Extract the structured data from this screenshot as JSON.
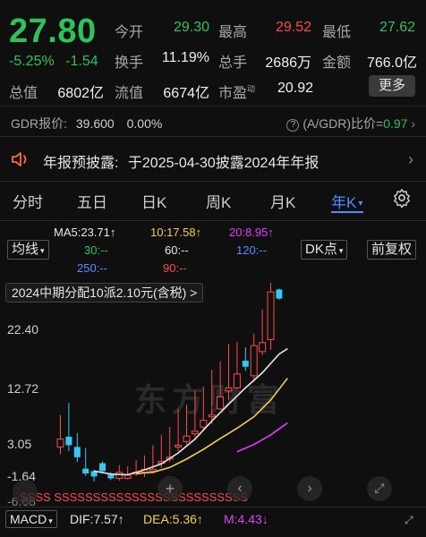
{
  "quote": {
    "price": "27.80",
    "change_pct": "-5.25%",
    "change_abs": "-1.54",
    "rows": [
      [
        {
          "label": "今开",
          "value": "29.30",
          "color": "green"
        },
        {
          "label": "最高",
          "value": "29.52",
          "color": "red"
        },
        {
          "label": "最低",
          "value": "27.62",
          "color": "green"
        }
      ],
      [
        {
          "label": "换手",
          "value": "11.19%",
          "color": "white"
        },
        {
          "label": "总手",
          "value": "2686万",
          "color": "white"
        },
        {
          "label": "金额",
          "value": "766.0亿",
          "color": "white"
        }
      ],
      [
        {
          "label": "总值",
          "value": "6802亿",
          "color": "white"
        },
        {
          "label": "流值",
          "value": "6674亿",
          "color": "white"
        },
        {
          "label": "市盈",
          "value": "20.92",
          "color": "white",
          "sup": "动"
        }
      ]
    ],
    "more_label": "更多"
  },
  "gdr": {
    "label": "GDR报价:",
    "price": "39.600",
    "pct": "0.00%",
    "ratio_label": "(A/GDR)比价=",
    "ratio": "0.97"
  },
  "notice": {
    "title": "年报预披露:",
    "text": "于2025-04-30披露2024年年报"
  },
  "tabs": [
    "分时",
    "五日",
    "日K",
    "周K",
    "月K",
    "年K"
  ],
  "active_tab": "年K",
  "indicators": {
    "ma_btn": "均线",
    "dk_btn": "DK点",
    "fq_btn": "前复权",
    "ma": [
      {
        "label": "MA5:23.71↑",
        "color": "#e6e6e6"
      },
      {
        "label": "10:17.58↑",
        "color": "#f2d24a"
      },
      {
        "label": "20:8.95↑",
        "color": "#e040fb"
      },
      {
        "label": "30:--",
        "color": "#2fc25b"
      },
      {
        "label": "60:--",
        "color": "#e6e6e6"
      },
      {
        "label": "120:--",
        "color": "#5a8cff"
      },
      {
        "label": "250:--",
        "color": "#5a8cff"
      },
      {
        "label": "90:--",
        "color": "#ff4a4a"
      }
    ]
  },
  "chart_data": {
    "type": "candlestick",
    "dividend_label": "2024中期分配10派2.10元(含税) >",
    "y_ticks": [
      "22.40",
      "12.72",
      "3.05",
      "-1.64",
      "-6.68"
    ],
    "watermark": "东方财富",
    "candles": [
      [
        4.5,
        8.5,
        3.2,
        2.0,
        "up"
      ],
      [
        4.9,
        10.5,
        3.5,
        2.5,
        "down"
      ],
      [
        3.2,
        5.5,
        1.5,
        0.7,
        "down"
      ],
      [
        -0.4,
        3.0,
        -1.2,
        -1.6,
        "down"
      ],
      [
        -0.8,
        -0.6,
        -1.7,
        -2.5,
        "down"
      ],
      [
        0.5,
        0.8,
        -0.8,
        -1.2,
        "down"
      ],
      [
        -1.4,
        -1.0,
        -2.0,
        -2.3,
        "down"
      ],
      [
        -1.0,
        0.2,
        -2.0,
        -2.4,
        "up"
      ],
      [
        -1.5,
        0.0,
        -2.0,
        -2.2,
        "up"
      ],
      [
        -1.0,
        1.0,
        -1.3,
        -1.6,
        "up"
      ],
      [
        -0.5,
        1.8,
        -1.0,
        -1.8,
        "up"
      ],
      [
        -0.5,
        3.5,
        -0.6,
        -1.2,
        "up"
      ],
      [
        0.8,
        5.2,
        0.5,
        -0.3,
        "up"
      ],
      [
        1.3,
        6.5,
        1.5,
        0.7,
        "up"
      ],
      [
        3.5,
        9.5,
        3.2,
        2.5,
        "up"
      ],
      [
        4.1,
        10.2,
        5.0,
        3.6,
        "up"
      ],
      [
        5.4,
        12.5,
        5.8,
        4.8,
        "up"
      ],
      [
        6.5,
        13.2,
        7.6,
        5.9,
        "up"
      ],
      [
        8.5,
        16.0,
        8.2,
        7.0,
        "up"
      ],
      [
        9.5,
        17.4,
        11.5,
        9.4,
        "up"
      ],
      [
        12.5,
        20.3,
        13.0,
        11.0,
        "up"
      ],
      [
        13.0,
        20.6,
        15.3,
        12.8,
        "up"
      ],
      [
        16.5,
        19.7,
        17.5,
        15.8,
        "down"
      ],
      [
        15.0,
        22.0,
        20.0,
        14.0,
        "up"
      ],
      [
        19.0,
        26.0,
        20.5,
        18.4,
        "up"
      ],
      [
        21.0,
        30.4,
        28.9,
        19.3,
        "up"
      ],
      [
        29.3,
        29.5,
        27.8,
        27.6,
        "down"
      ]
    ]
  },
  "macd": {
    "btn": "MACD",
    "dif": "DIF:7.57↑",
    "dea": "DEA:5.36↑",
    "m": "M:4.43↓"
  }
}
